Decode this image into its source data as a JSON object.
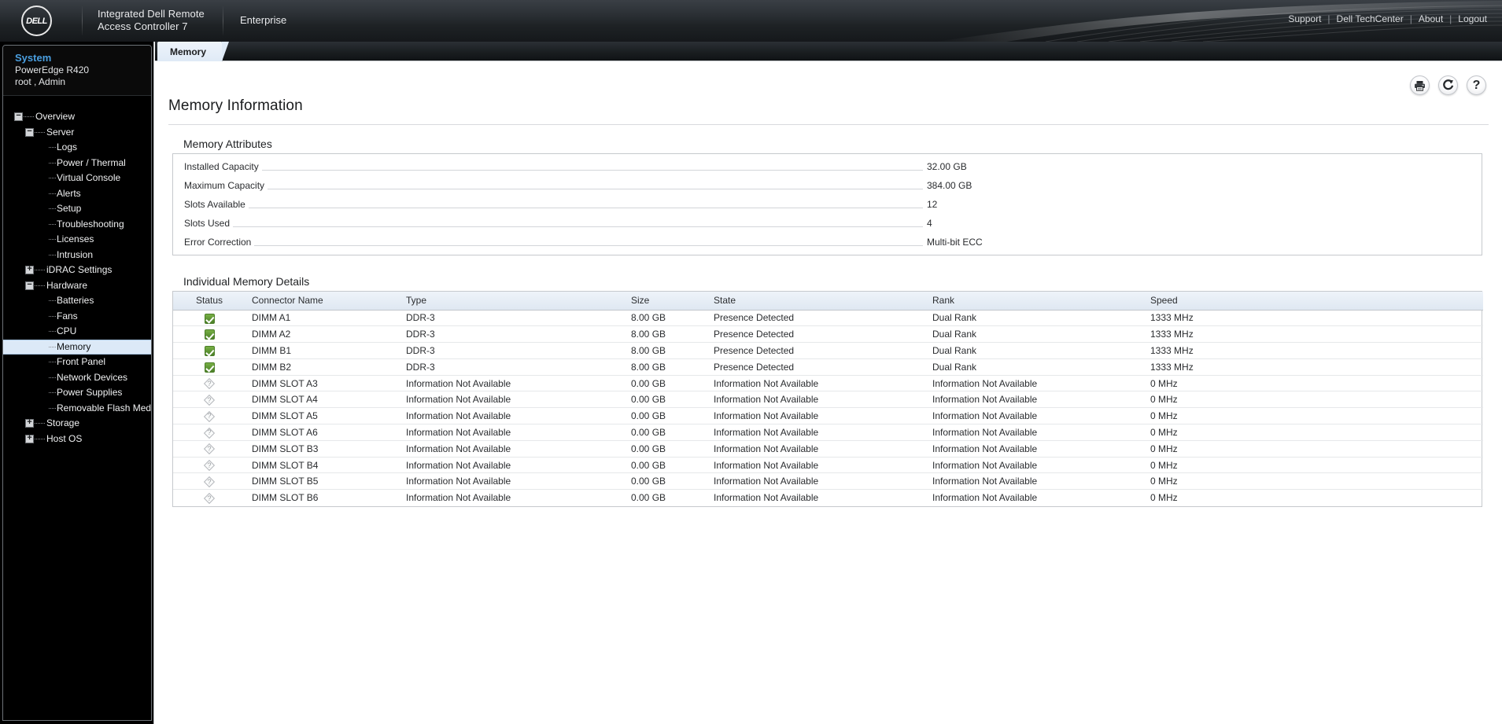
{
  "header": {
    "logo_text": "DELL",
    "product_name_line1": "Integrated Dell Remote",
    "product_name_line2": "Access Controller 7",
    "edition": "Enterprise",
    "links": [
      {
        "label": "Support"
      },
      {
        "label": "Dell TechCenter"
      },
      {
        "label": "About"
      },
      {
        "label": "Logout"
      }
    ],
    "separator": "|"
  },
  "sidebar": {
    "system_title": "System",
    "system_model": "PowerEdge R420",
    "system_user": "root , Admin",
    "tree": [
      {
        "label": "Overview",
        "level": 0,
        "toggle": "minus",
        "selected": false
      },
      {
        "label": "Server",
        "level": 1,
        "toggle": "minus",
        "selected": false
      },
      {
        "label": "Logs",
        "level": 2,
        "toggle": "none",
        "selected": false
      },
      {
        "label": "Power / Thermal",
        "level": 2,
        "toggle": "none",
        "selected": false
      },
      {
        "label": "Virtual Console",
        "level": 2,
        "toggle": "none",
        "selected": false
      },
      {
        "label": "Alerts",
        "level": 2,
        "toggle": "none",
        "selected": false
      },
      {
        "label": "Setup",
        "level": 2,
        "toggle": "none",
        "selected": false
      },
      {
        "label": "Troubleshooting",
        "level": 2,
        "toggle": "none",
        "selected": false
      },
      {
        "label": "Licenses",
        "level": 2,
        "toggle": "none",
        "selected": false
      },
      {
        "label": "Intrusion",
        "level": 2,
        "toggle": "none",
        "selected": false
      },
      {
        "label": "iDRAC Settings",
        "level": 1,
        "toggle": "plus",
        "selected": false
      },
      {
        "label": "Hardware",
        "level": 1,
        "toggle": "minus",
        "selected": false
      },
      {
        "label": "Batteries",
        "level": 2,
        "toggle": "none",
        "selected": false
      },
      {
        "label": "Fans",
        "level": 2,
        "toggle": "none",
        "selected": false
      },
      {
        "label": "CPU",
        "level": 2,
        "toggle": "none",
        "selected": false
      },
      {
        "label": "Memory",
        "level": 2,
        "toggle": "none",
        "selected": true
      },
      {
        "label": "Front Panel",
        "level": 2,
        "toggle": "none",
        "selected": false
      },
      {
        "label": "Network Devices",
        "level": 2,
        "toggle": "none",
        "selected": false
      },
      {
        "label": "Power Supplies",
        "level": 2,
        "toggle": "none",
        "selected": false
      },
      {
        "label": "Removable Flash Media",
        "level": 2,
        "toggle": "none",
        "selected": false
      },
      {
        "label": "Storage",
        "level": 1,
        "toggle": "plus",
        "selected": false
      },
      {
        "label": "Host OS",
        "level": 1,
        "toggle": "plus",
        "selected": false
      }
    ]
  },
  "tabs": [
    {
      "label": "Memory",
      "active": true
    }
  ],
  "page": {
    "title": "Memory Information",
    "toolbar": [
      {
        "icon": "print-icon"
      },
      {
        "icon": "refresh-icon"
      },
      {
        "icon": "help-icon"
      }
    ]
  },
  "memory_attributes": {
    "heading": "Memory Attributes",
    "rows": [
      {
        "label": "Installed Capacity",
        "value": "32.00 GB"
      },
      {
        "label": "Maximum Capacity",
        "value": "384.00 GB"
      },
      {
        "label": "Slots Available",
        "value": "12"
      },
      {
        "label": "Slots Used",
        "value": "4"
      },
      {
        "label": "Error Correction",
        "value": "Multi-bit ECC"
      }
    ]
  },
  "memory_details": {
    "heading": "Individual Memory Details",
    "columns": [
      "Status",
      "Connector Name",
      "Type",
      "Size",
      "State",
      "Rank",
      "Speed"
    ],
    "rows": [
      {
        "status": "ok",
        "connector": "DIMM A1",
        "type": "DDR-3",
        "size": "8.00 GB",
        "state": "Presence Detected",
        "rank": "Dual Rank",
        "speed": "1333 MHz"
      },
      {
        "status": "ok",
        "connector": "DIMM A2",
        "type": "DDR-3",
        "size": "8.00 GB",
        "state": "Presence Detected",
        "rank": "Dual Rank",
        "speed": "1333 MHz"
      },
      {
        "status": "ok",
        "connector": "DIMM B1",
        "type": "DDR-3",
        "size": "8.00 GB",
        "state": "Presence Detected",
        "rank": "Dual Rank",
        "speed": "1333 MHz"
      },
      {
        "status": "ok",
        "connector": "DIMM B2",
        "type": "DDR-3",
        "size": "8.00 GB",
        "state": "Presence Detected",
        "rank": "Dual Rank",
        "speed": "1333 MHz"
      },
      {
        "status": "unknown",
        "connector": "DIMM SLOT A3",
        "type": "Information Not Available",
        "size": "0.00 GB",
        "state": "Information Not Available",
        "rank": "Information Not Available",
        "speed": "0 MHz"
      },
      {
        "status": "unknown",
        "connector": "DIMM SLOT A4",
        "type": "Information Not Available",
        "size": "0.00 GB",
        "state": "Information Not Available",
        "rank": "Information Not Available",
        "speed": "0 MHz"
      },
      {
        "status": "unknown",
        "connector": "DIMM SLOT A5",
        "type": "Information Not Available",
        "size": "0.00 GB",
        "state": "Information Not Available",
        "rank": "Information Not Available",
        "speed": "0 MHz"
      },
      {
        "status": "unknown",
        "connector": "DIMM SLOT A6",
        "type": "Information Not Available",
        "size": "0.00 GB",
        "state": "Information Not Available",
        "rank": "Information Not Available",
        "speed": "0 MHz"
      },
      {
        "status": "unknown",
        "connector": "DIMM SLOT B3",
        "type": "Information Not Available",
        "size": "0.00 GB",
        "state": "Information Not Available",
        "rank": "Information Not Available",
        "speed": "0 MHz"
      },
      {
        "status": "unknown",
        "connector": "DIMM SLOT B4",
        "type": "Information Not Available",
        "size": "0.00 GB",
        "state": "Information Not Available",
        "rank": "Information Not Available",
        "speed": "0 MHz"
      },
      {
        "status": "unknown",
        "connector": "DIMM SLOT B5",
        "type": "Information Not Available",
        "size": "0.00 GB",
        "state": "Information Not Available",
        "rank": "Information Not Available",
        "speed": "0 MHz"
      },
      {
        "status": "unknown",
        "connector": "DIMM SLOT B6",
        "type": "Information Not Available",
        "size": "0.00 GB",
        "state": "Information Not Available",
        "rank": "Information Not Available",
        "speed": "0 MHz"
      }
    ]
  },
  "colors": {
    "accent_blue": "#4a9fe0",
    "status_ok_green": "#5d9433",
    "status_unknown_gray": "#b4b7bb",
    "header_dark": "#1e2225",
    "tab_active": "#dfeaf6"
  }
}
